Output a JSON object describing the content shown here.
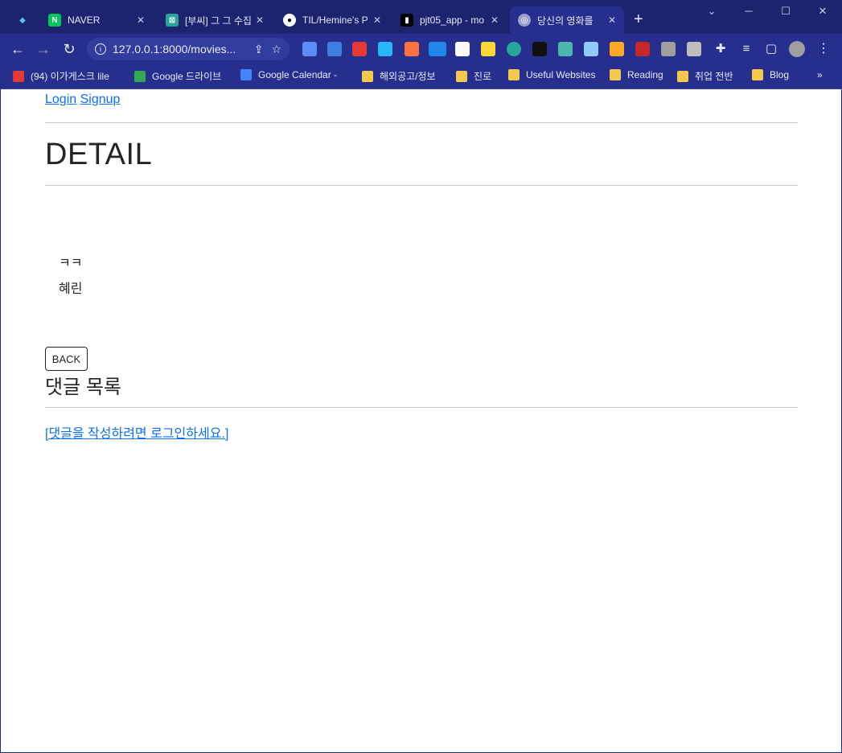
{
  "browser": {
    "tabs": [
      {
        "title": "",
        "icon": "pin-icon"
      },
      {
        "title": "NAVER",
        "icon": "naver-icon"
      },
      {
        "title": "[부씨] 그 그 수집",
        "icon": "site-icon"
      },
      {
        "title": "TIL/Hemine's P",
        "icon": "github-icon"
      },
      {
        "title": "pjt05_app - mo",
        "icon": "terminal-icon"
      },
      {
        "title": "당신의 영화를 ",
        "icon": "globe-icon"
      }
    ],
    "url": "127.0.0.1:8000/movies...",
    "bookmarks": [
      "(94) 이가게스크 lile",
      "Google 드라이브",
      "Google Calendar -",
      "해외공고/정보",
      "진로",
      "Useful Websites",
      "Reading",
      "취업 전반",
      "Blog"
    ],
    "more_bookmarks": "»"
  },
  "nav": {
    "login": "Login",
    "signup": "Signup"
  },
  "page": {
    "title": "DETAIL",
    "movie_title": "ㅋㅋ",
    "movie_content": "혜린",
    "back_button": "BACK",
    "comments_heading": "댓글 목록",
    "login_prompt": "[댓글을 작성하려면 로그인하세요.]"
  }
}
